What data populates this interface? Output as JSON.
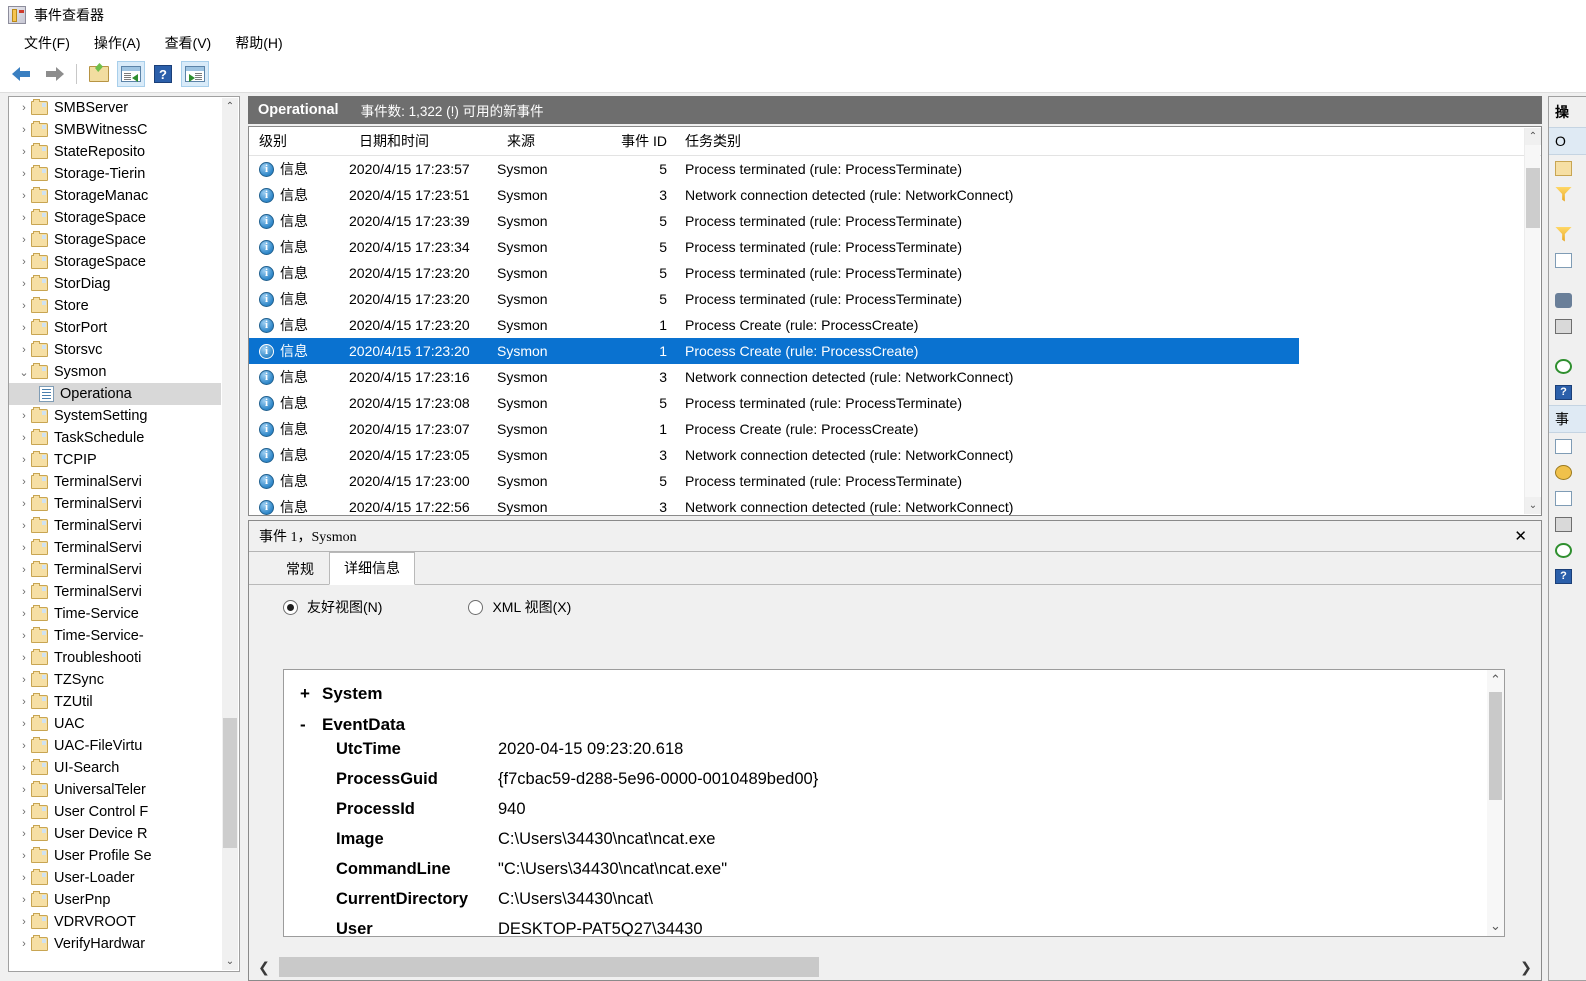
{
  "window": {
    "title": "事件查看器",
    "icon": "event-viewer-icon"
  },
  "menu": [
    {
      "label": "文件(F)"
    },
    {
      "label": "操作(A)"
    },
    {
      "label": "查看(V)"
    },
    {
      "label": "帮助(H)"
    }
  ],
  "toolbar": [
    {
      "name": "back-button",
      "icon": "arrow-left-icon"
    },
    {
      "name": "forward-button",
      "icon": "arrow-right-icon"
    },
    {
      "name": "up-one-level-button",
      "icon": "folder-open-icon"
    },
    {
      "name": "show-hide-console-tree-button",
      "icon": "console-tree-icon"
    },
    {
      "name": "help-button",
      "icon": "question-mark-icon"
    },
    {
      "name": "show-hide-action-pane-button",
      "icon": "action-pane-icon"
    }
  ],
  "tree": {
    "items": [
      {
        "label": "SMBServer",
        "type": "folder",
        "expanded": false
      },
      {
        "label": "SMBWitnessC",
        "type": "folder",
        "expanded": false
      },
      {
        "label": "StateReposito",
        "type": "folder",
        "expanded": false
      },
      {
        "label": "Storage-Tierin",
        "type": "folder",
        "expanded": false
      },
      {
        "label": "StorageManac",
        "type": "folder",
        "expanded": false
      },
      {
        "label": "StorageSpace",
        "type": "folder",
        "expanded": false
      },
      {
        "label": "StorageSpace",
        "type": "folder",
        "expanded": false
      },
      {
        "label": "StorageSpace",
        "type": "folder",
        "expanded": false
      },
      {
        "label": "StorDiag",
        "type": "folder",
        "expanded": false
      },
      {
        "label": "Store",
        "type": "folder",
        "expanded": false
      },
      {
        "label": "StorPort",
        "type": "folder",
        "expanded": false
      },
      {
        "label": "Storsvc",
        "type": "folder",
        "expanded": false
      },
      {
        "label": "Sysmon",
        "type": "folder",
        "expanded": true
      },
      {
        "label": "Operationa",
        "type": "log",
        "child": true,
        "selected": true
      },
      {
        "label": "SystemSetting",
        "type": "folder",
        "expanded": false
      },
      {
        "label": "TaskSchedule",
        "type": "folder",
        "expanded": false
      },
      {
        "label": "TCPIP",
        "type": "folder",
        "expanded": false
      },
      {
        "label": "TerminalServi",
        "type": "folder",
        "expanded": false
      },
      {
        "label": "TerminalServi",
        "type": "folder",
        "expanded": false
      },
      {
        "label": "TerminalServi",
        "type": "folder",
        "expanded": false
      },
      {
        "label": "TerminalServi",
        "type": "folder",
        "expanded": false
      },
      {
        "label": "TerminalServi",
        "type": "folder",
        "expanded": false
      },
      {
        "label": "TerminalServi",
        "type": "folder",
        "expanded": false
      },
      {
        "label": "Time-Service",
        "type": "folder",
        "expanded": false
      },
      {
        "label": "Time-Service-",
        "type": "folder",
        "expanded": false
      },
      {
        "label": "Troubleshooti",
        "type": "folder",
        "expanded": false
      },
      {
        "label": "TZSync",
        "type": "folder",
        "expanded": false
      },
      {
        "label": "TZUtil",
        "type": "folder",
        "expanded": false
      },
      {
        "label": "UAC",
        "type": "folder",
        "expanded": false
      },
      {
        "label": "UAC-FileVirtu",
        "type": "folder",
        "expanded": false
      },
      {
        "label": "UI-Search",
        "type": "folder",
        "expanded": false
      },
      {
        "label": "UniversalTeler",
        "type": "folder",
        "expanded": false
      },
      {
        "label": "User Control F",
        "type": "folder",
        "expanded": false
      },
      {
        "label": "User Device R",
        "type": "folder",
        "expanded": false
      },
      {
        "label": "User Profile Se",
        "type": "folder",
        "expanded": false
      },
      {
        "label": "User-Loader",
        "type": "folder",
        "expanded": false
      },
      {
        "label": "UserPnp",
        "type": "folder",
        "expanded": false
      },
      {
        "label": "VDRVROOT",
        "type": "folder",
        "expanded": false
      },
      {
        "label": "VerifyHardwar",
        "type": "folder",
        "expanded": false
      }
    ]
  },
  "log_header": {
    "name": "Operational",
    "count_text": "事件数: 1,322 (!) 可用的新事件"
  },
  "list": {
    "columns": [
      {
        "key": "level",
        "label": "级别"
      },
      {
        "key": "date",
        "label": "日期和时间"
      },
      {
        "key": "source",
        "label": "来源"
      },
      {
        "key": "eid",
        "label": "事件 ID"
      },
      {
        "key": "task",
        "label": "任务类别"
      }
    ],
    "rows": [
      {
        "level": "信息",
        "date": "2020/4/15 17:23:57",
        "source": "Sysmon",
        "eid": "5",
        "task": "Process terminated (rule: ProcessTerminate)",
        "selected": false
      },
      {
        "level": "信息",
        "date": "2020/4/15 17:23:51",
        "source": "Sysmon",
        "eid": "3",
        "task": "Network connection detected (rule: NetworkConnect)",
        "selected": false
      },
      {
        "level": "信息",
        "date": "2020/4/15 17:23:39",
        "source": "Sysmon",
        "eid": "5",
        "task": "Process terminated (rule: ProcessTerminate)",
        "selected": false
      },
      {
        "level": "信息",
        "date": "2020/4/15 17:23:34",
        "source": "Sysmon",
        "eid": "5",
        "task": "Process terminated (rule: ProcessTerminate)",
        "selected": false
      },
      {
        "level": "信息",
        "date": "2020/4/15 17:23:20",
        "source": "Sysmon",
        "eid": "5",
        "task": "Process terminated (rule: ProcessTerminate)",
        "selected": false
      },
      {
        "level": "信息",
        "date": "2020/4/15 17:23:20",
        "source": "Sysmon",
        "eid": "5",
        "task": "Process terminated (rule: ProcessTerminate)",
        "selected": false
      },
      {
        "level": "信息",
        "date": "2020/4/15 17:23:20",
        "source": "Sysmon",
        "eid": "1",
        "task": "Process Create (rule: ProcessCreate)",
        "selected": false
      },
      {
        "level": "信息",
        "date": "2020/4/15 17:23:20",
        "source": "Sysmon",
        "eid": "1",
        "task": "Process Create (rule: ProcessCreate)",
        "selected": true
      },
      {
        "level": "信息",
        "date": "2020/4/15 17:23:16",
        "source": "Sysmon",
        "eid": "3",
        "task": "Network connection detected (rule: NetworkConnect)",
        "selected": false
      },
      {
        "level": "信息",
        "date": "2020/4/15 17:23:08",
        "source": "Sysmon",
        "eid": "5",
        "task": "Process terminated (rule: ProcessTerminate)",
        "selected": false
      },
      {
        "level": "信息",
        "date": "2020/4/15 17:23:07",
        "source": "Sysmon",
        "eid": "1",
        "task": "Process Create (rule: ProcessCreate)",
        "selected": false
      },
      {
        "level": "信息",
        "date": "2020/4/15 17:23:05",
        "source": "Sysmon",
        "eid": "3",
        "task": "Network connection detected (rule: NetworkConnect)",
        "selected": false
      },
      {
        "level": "信息",
        "date": "2020/4/15 17:23:00",
        "source": "Sysmon",
        "eid": "5",
        "task": "Process terminated (rule: ProcessTerminate)",
        "selected": false
      },
      {
        "level": "信息",
        "date": "2020/4/15 17:22:56",
        "source": "Sysmon",
        "eid": "3",
        "task": "Network connection detected (rule: NetworkConnect)",
        "selected": false
      }
    ]
  },
  "detail": {
    "header": "事件 1，Sysmon",
    "close_label": "✕",
    "tabs": [
      {
        "label": "常规",
        "active": false
      },
      {
        "label": "详细信息",
        "active": true
      }
    ],
    "view_options": [
      {
        "label": "友好视图(N)",
        "selected": true
      },
      {
        "label": "XML 视图(X)",
        "selected": false
      }
    ],
    "nodes": [
      {
        "sign": "+",
        "label": "System"
      },
      {
        "sign": "-",
        "label": "EventData"
      }
    ],
    "fields": [
      {
        "key": "UtcTime",
        "value": "2020-04-15 09:23:20.618"
      },
      {
        "key": "ProcessGuid",
        "value": "{f7cbac59-d288-5e96-0000-0010489bed00}"
      },
      {
        "key": "ProcessId",
        "value": "940"
      },
      {
        "key": "Image",
        "value": "C:\\Users\\34430\\ncat\\ncat.exe"
      },
      {
        "key": "CommandLine",
        "value": "\"C:\\Users\\34430\\ncat\\ncat.exe\""
      },
      {
        "key": "CurrentDirectory",
        "value": "C:\\Users\\34430\\ncat\\"
      },
      {
        "key": "User",
        "value": "DESKTOP-PAT5Q27\\34430"
      }
    ]
  },
  "actions": {
    "title": "操",
    "section_log": "O",
    "section_event": "事",
    "items": [
      {
        "icon": "folder-open-icon"
      },
      {
        "icon": "filter-funnel-icon"
      },
      {
        "icon": "clear-filter-icon"
      },
      {
        "icon": "properties-icon"
      },
      {
        "icon": "find-icon"
      },
      {
        "icon": "save-events-icon"
      },
      {
        "icon": "refresh-icon"
      },
      {
        "icon": "help-icon"
      },
      {
        "icon": "event-properties-icon"
      },
      {
        "icon": "attach-task-icon"
      },
      {
        "icon": "copy-icon"
      },
      {
        "icon": "save-selected-icon"
      },
      {
        "icon": "refresh-icon"
      },
      {
        "icon": "help-icon"
      }
    ]
  },
  "colors": {
    "header_bar": "#6e6e6e",
    "selection": "#0a72d0",
    "accent": "#2e86c8"
  }
}
